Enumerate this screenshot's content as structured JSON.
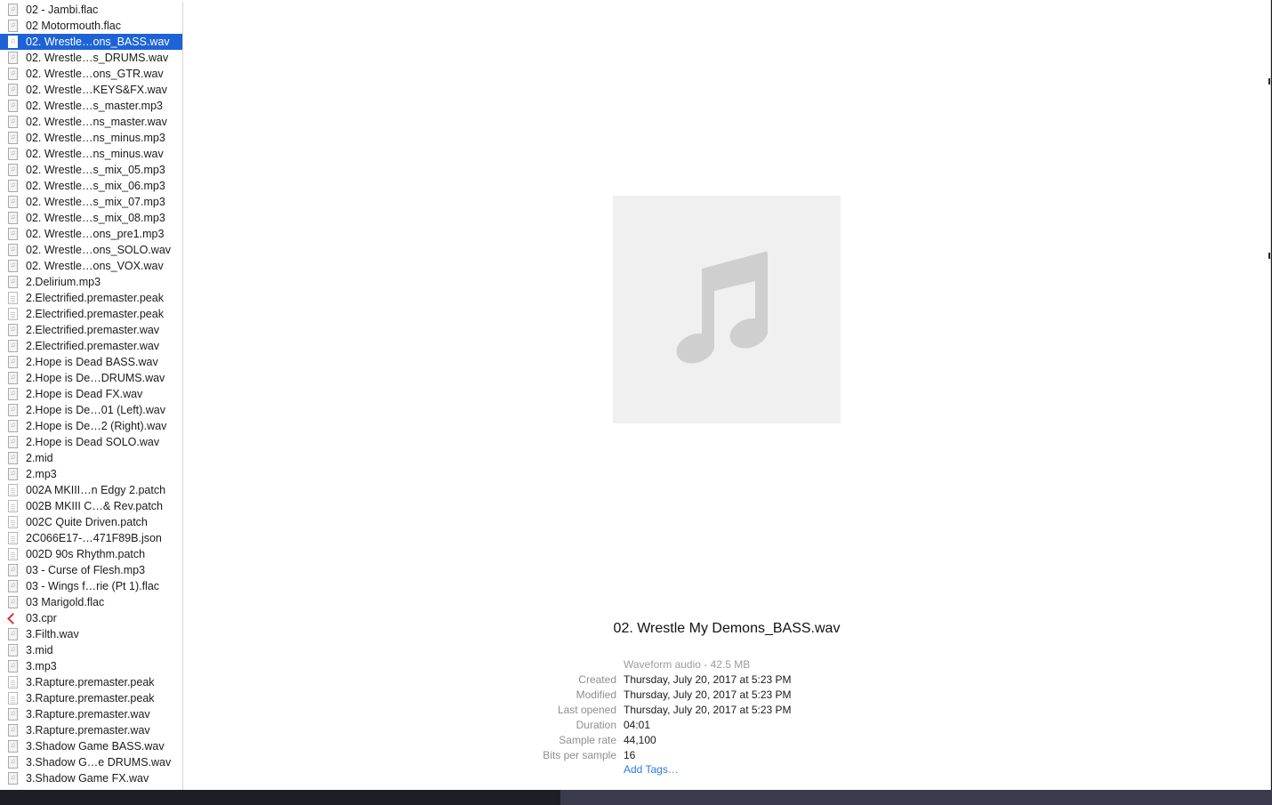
{
  "file_list": [
    {
      "name": "02 - Jambi.flac",
      "icon": "audio-file-icon"
    },
    {
      "name": "02 Motormouth.flac",
      "icon": "audio-file-icon"
    },
    {
      "name": "02. Wrestle…ons_BASS.wav",
      "icon": "audio-file-icon",
      "selected": true
    },
    {
      "name": "02. Wrestle…s_DRUMS.wav",
      "icon": "audio-file-icon"
    },
    {
      "name": "02. Wrestle…ons_GTR.wav",
      "icon": "audio-file-icon"
    },
    {
      "name": "02. Wrestle…KEYS&FX.wav",
      "icon": "audio-file-icon"
    },
    {
      "name": "02. Wrestle…s_master.mp3",
      "icon": "audio-file-icon"
    },
    {
      "name": "02. Wrestle…ns_master.wav",
      "icon": "audio-file-icon"
    },
    {
      "name": "02. Wrestle…ns_minus.mp3",
      "icon": "audio-file-icon"
    },
    {
      "name": "02. Wrestle…ns_minus.wav",
      "icon": "audio-file-icon"
    },
    {
      "name": "02. Wrestle…s_mix_05.mp3",
      "icon": "audio-file-icon"
    },
    {
      "name": "02. Wrestle…s_mix_06.mp3",
      "icon": "audio-file-icon"
    },
    {
      "name": "02. Wrestle…s_mix_07.mp3",
      "icon": "audio-file-icon"
    },
    {
      "name": "02. Wrestle…s_mix_08.mp3",
      "icon": "audio-file-icon"
    },
    {
      "name": "02. Wrestle…ons_pre1.mp3",
      "icon": "audio-file-icon"
    },
    {
      "name": "02. Wrestle…ons_SOLO.wav",
      "icon": "audio-file-icon"
    },
    {
      "name": "02. Wrestle…ons_VOX.wav",
      "icon": "audio-file-icon"
    },
    {
      "name": "2.Delirium.mp3",
      "icon": "audio-file-icon"
    },
    {
      "name": "2.Electrified.premaster.peak",
      "icon": "document-file-icon"
    },
    {
      "name": "2.Electrified.premaster.peak",
      "icon": "document-file-icon"
    },
    {
      "name": "2.Electrified.premaster.wav",
      "icon": "audio-file-icon"
    },
    {
      "name": "2.Electrified.premaster.wav",
      "icon": "audio-file-icon"
    },
    {
      "name": "2.Hope is Dead BASS.wav",
      "icon": "audio-file-icon"
    },
    {
      "name": "2.Hope is De…DRUMS.wav",
      "icon": "audio-file-icon"
    },
    {
      "name": "2.Hope is Dead FX.wav",
      "icon": "audio-file-icon"
    },
    {
      "name": "2.Hope is De…01 (Left).wav",
      "icon": "audio-file-icon"
    },
    {
      "name": "2.Hope is De…2 (Right).wav",
      "icon": "audio-file-icon"
    },
    {
      "name": "2.Hope is Dead SOLO.wav",
      "icon": "audio-file-icon"
    },
    {
      "name": "2.mid",
      "icon": "audio-file-icon"
    },
    {
      "name": "2.mp3",
      "icon": "audio-file-icon"
    },
    {
      "name": "002A MKIII…n Edgy 2.patch",
      "icon": "document-file-icon"
    },
    {
      "name": "002B MKIII C…& Rev.patch",
      "icon": "document-file-icon"
    },
    {
      "name": "002C Quite Driven.patch",
      "icon": "document-file-icon"
    },
    {
      "name": "2C066E17-…471F89B.json",
      "icon": "document-file-icon"
    },
    {
      "name": "002D 90s Rhythm.patch",
      "icon": "document-file-icon"
    },
    {
      "name": "03 - Curse of Flesh.mp3",
      "icon": "audio-file-icon"
    },
    {
      "name": "03 - Wings f…rie (Pt 1).flac",
      "icon": "audio-file-icon"
    },
    {
      "name": "03 Marigold.flac",
      "icon": "audio-file-icon"
    },
    {
      "name": "03.cpr",
      "icon": "cubase-project-icon"
    },
    {
      "name": "3.Filth.wav",
      "icon": "audio-file-icon"
    },
    {
      "name": "3.mid",
      "icon": "audio-file-icon"
    },
    {
      "name": "3.mp3",
      "icon": "audio-file-icon"
    },
    {
      "name": "3.Rapture.premaster.peak",
      "icon": "document-file-icon"
    },
    {
      "name": "3.Rapture.premaster.peak",
      "icon": "document-file-icon"
    },
    {
      "name": "3.Rapture.premaster.wav",
      "icon": "audio-file-icon"
    },
    {
      "name": "3.Rapture.premaster.wav",
      "icon": "audio-file-icon"
    },
    {
      "name": "3.Shadow Game BASS.wav",
      "icon": "audio-file-icon"
    },
    {
      "name": "3.Shadow G…e DRUMS.wav",
      "icon": "audio-file-icon"
    },
    {
      "name": "3.Shadow Game FX.wav",
      "icon": "audio-file-icon"
    }
  ],
  "preview": {
    "artwork_icon": "music-note-icon",
    "title": "02. Wrestle My Demons_BASS.wav",
    "kind": "Waveform audio - 42.5 MB",
    "info": [
      {
        "label": "Created",
        "value": "Thursday, July 20, 2017 at 5:23 PM"
      },
      {
        "label": "Modified",
        "value": "Thursday, July 20, 2017 at 5:23 PM"
      },
      {
        "label": "Last opened",
        "value": "Thursday, July 20, 2017 at 5:23 PM"
      },
      {
        "label": "Duration",
        "value": "04:01"
      },
      {
        "label": "Sample rate",
        "value": "44,100"
      },
      {
        "label": "Bits per sample",
        "value": "16"
      }
    ],
    "add_tags_label": "Add Tags…"
  },
  "colors": {
    "selection": "#1d63d6",
    "link": "#2a7ae2",
    "artwork_bg": "#f0f0f0",
    "note": "#cfcfcf"
  }
}
